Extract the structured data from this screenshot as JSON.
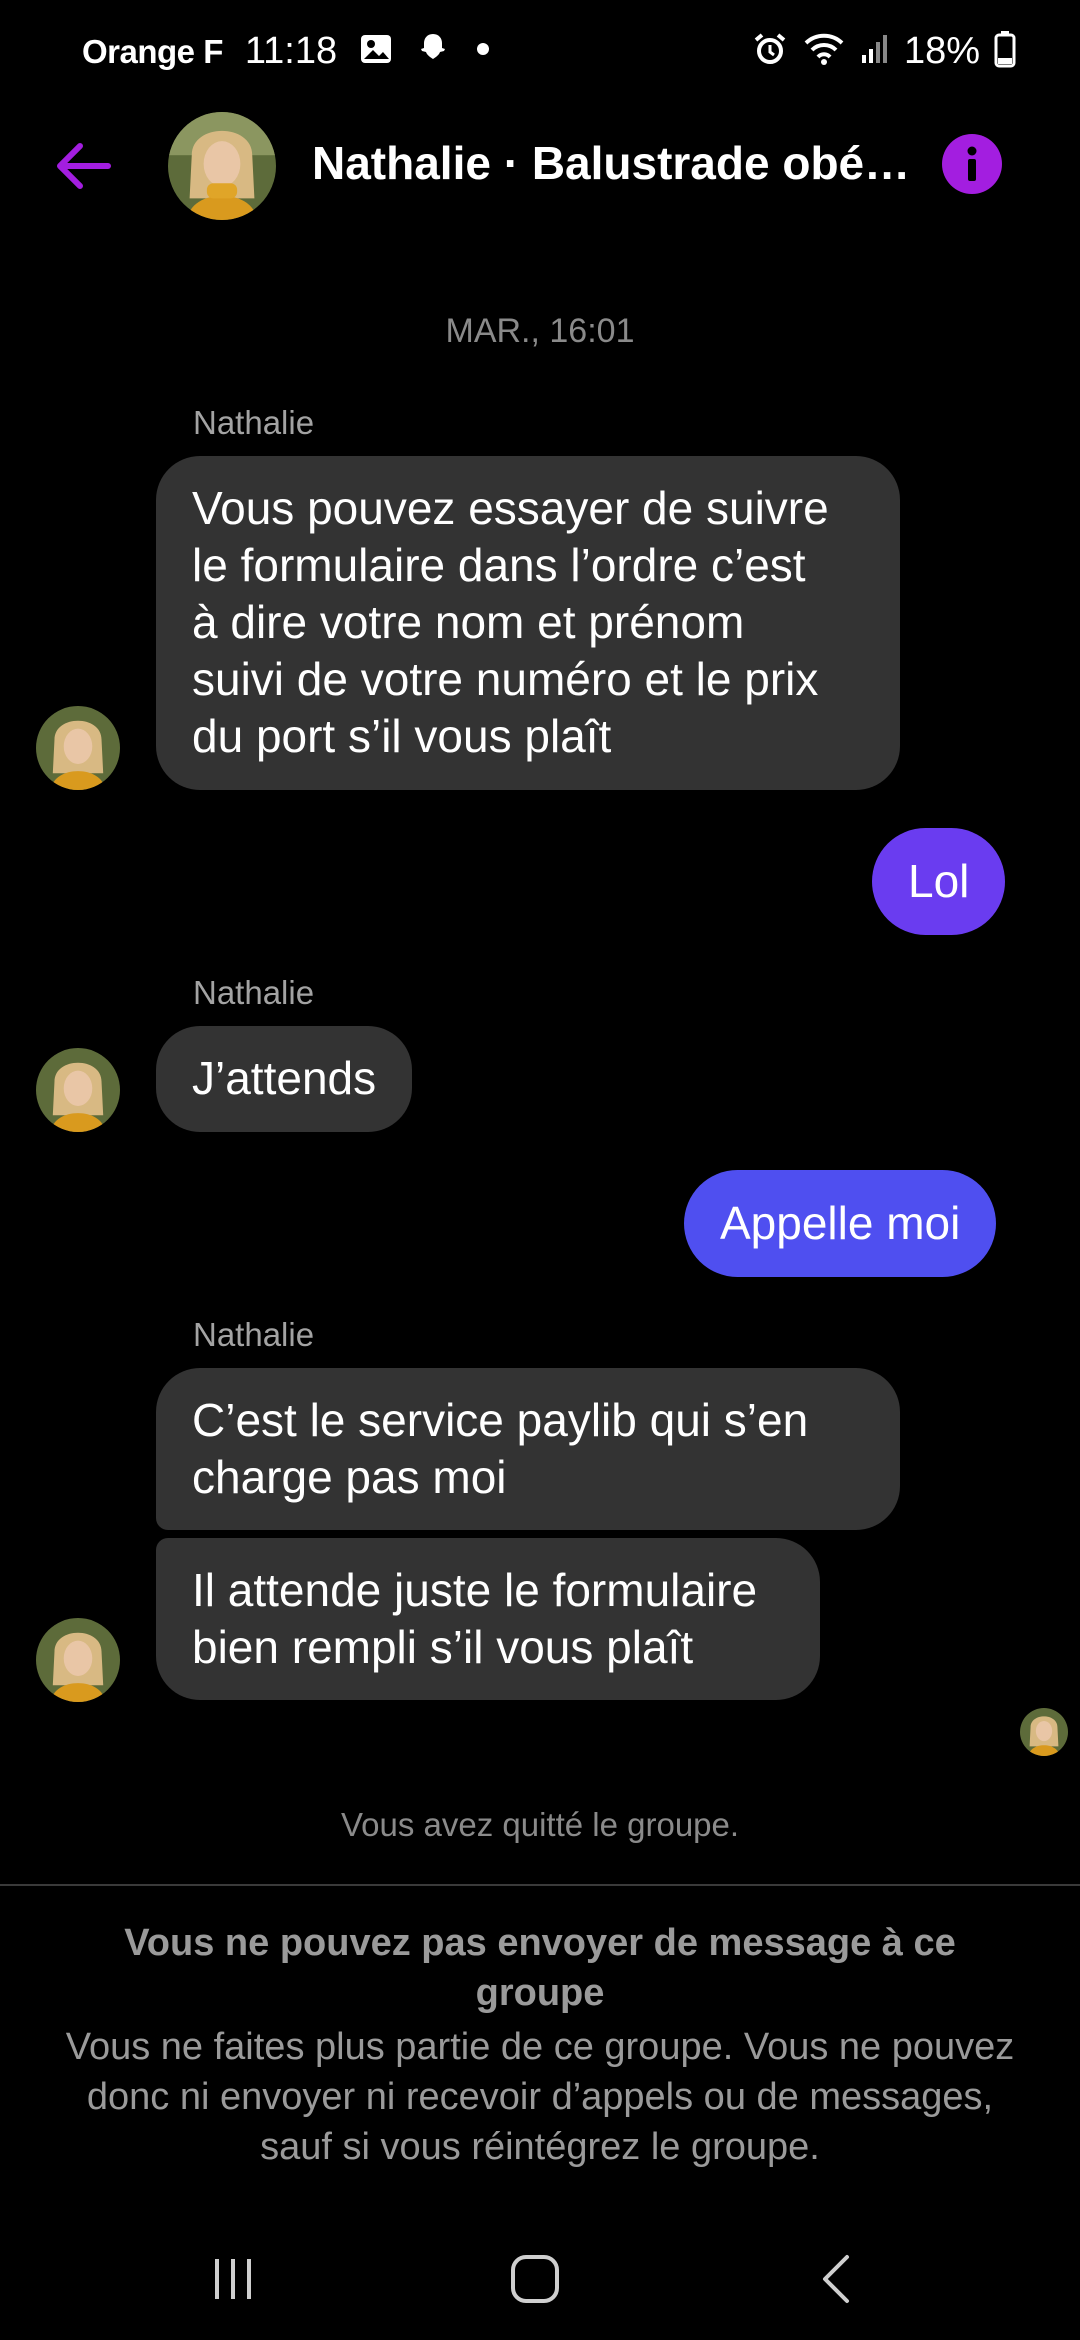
{
  "status_bar": {
    "carrier": "Orange F",
    "time": "11:18",
    "battery": "18%",
    "icons": [
      "gallery-icon",
      "snapchat-icon",
      "dot-icon",
      "alarm-icon",
      "wifi-icon",
      "signal-icon",
      "battery-icon"
    ]
  },
  "header": {
    "title": "Nathalie · Balustrade obéi…",
    "back_icon": "arrow-left-icon",
    "info_icon": "info-icon",
    "accent_color": "#a31ee0"
  },
  "conversation": {
    "date": "MAR., 16:01",
    "messages": [
      {
        "sender": "Nathalie",
        "text_lines": [
          "Vous pouvez essayer de suivre",
          "le formulaire dans l’ordre c’est",
          "à dire votre nom et prénom",
          "suivi de votre numéro et le prix",
          "du port s’il vous plaît"
        ]
      },
      {
        "sender": "me",
        "text": "Lol",
        "color": "#6a3cf0"
      },
      {
        "sender": "Nathalie",
        "text": "J’attends"
      },
      {
        "sender": "me",
        "text": "Appelle moi",
        "color": "#4f4ff0"
      },
      {
        "sender": "Nathalie",
        "text_lines": [
          "C’est le service paylib qui s’en",
          "charge pas moi"
        ]
      },
      {
        "sender": "Nathalie",
        "text_lines": [
          "Il attende juste le formulaire",
          "bien rempli s’il vous plaît"
        ]
      }
    ],
    "system_note": "Vous avez quitté le groupe."
  },
  "notice": {
    "title": "Vous ne pouvez pas envoyer de message à ce groupe",
    "body": "Vous ne faites plus partie de ce groupe. Vous ne pouvez donc ni envoyer ni recevoir d’appels ou de messages, sauf si vous réintégrez le groupe."
  },
  "navbar": {
    "icons": [
      "recent-apps-icon",
      "home-icon",
      "back-icon"
    ]
  }
}
